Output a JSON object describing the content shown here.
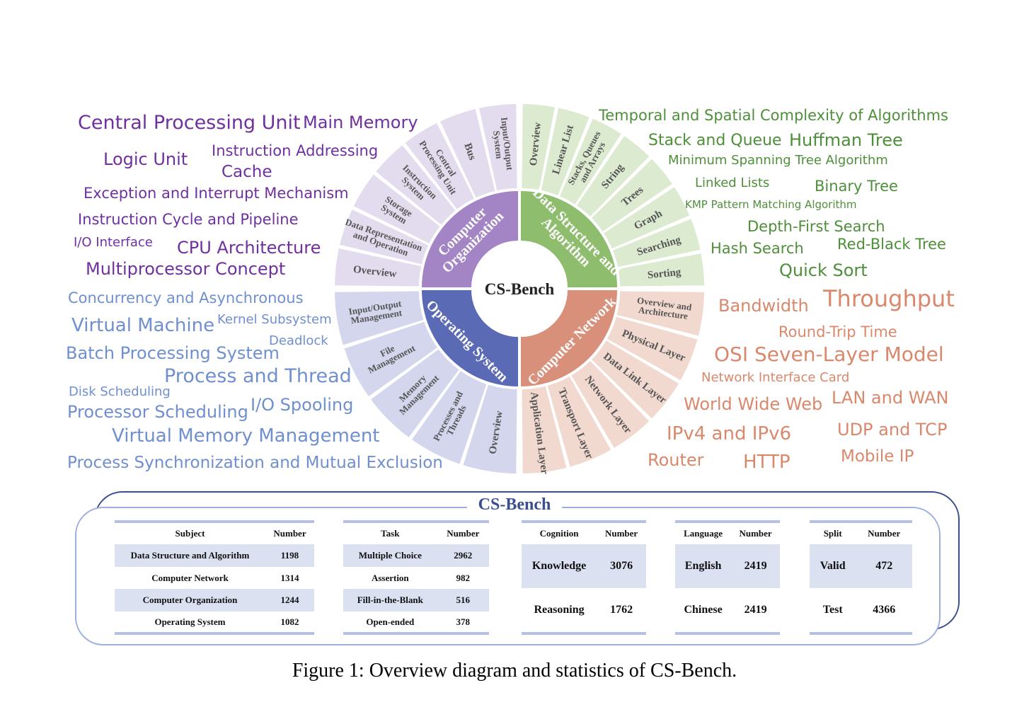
{
  "wheel": {
    "center_label": "CS-Bench",
    "sectors": [
      {
        "name": "Computer Organization",
        "lines": [
          "Computer",
          "Organization"
        ],
        "inner_color": "#a384c4",
        "outer_color": "#e3dbee",
        "subtopics": [
          [
            "Overview"
          ],
          [
            "Data Representation",
            "and Operation"
          ],
          [
            "Storage",
            "System"
          ],
          [
            "Instruction",
            "System"
          ],
          [
            "Central",
            "Processing Unit"
          ],
          [
            "Bus"
          ],
          [
            "Input/Output",
            "System"
          ]
        ]
      },
      {
        "name": "Data Structure and Algorithm",
        "lines": [
          "Data Structure and",
          "Algorithm"
        ],
        "inner_color": "#8fbd6e",
        "outer_color": "#dcead0",
        "subtopics": [
          [
            "Overview"
          ],
          [
            "Linear List"
          ],
          [
            "Stacks, Queues",
            "and Arrays"
          ],
          [
            "String"
          ],
          [
            "Trees"
          ],
          [
            "Graph"
          ],
          [
            "Searching"
          ],
          [
            "Sorting"
          ]
        ]
      },
      {
        "name": "Computer Network",
        "lines": [
          "Computer Network"
        ],
        "inner_color": "#d8907a",
        "outer_color": "#f2d9d0",
        "subtopics": [
          [
            "Overview and",
            "Architecture"
          ],
          [
            "Physical Layer"
          ],
          [
            "Data Link Layer"
          ],
          [
            "Network Layer"
          ],
          [
            "Transport Layer"
          ],
          [
            "Application Layer"
          ]
        ]
      },
      {
        "name": "Operating System",
        "lines": [
          "Operating System"
        ],
        "inner_color": "#5b6ab5",
        "outer_color": "#d3d6ec",
        "subtopics": [
          [
            "Input/Output",
            "Management"
          ],
          [
            "File",
            "Management"
          ],
          [
            "Memory",
            "Management"
          ],
          [
            "Processes and",
            "Threads"
          ],
          [
            "Overview"
          ]
        ]
      }
    ]
  },
  "word_clouds": {
    "computer_organization": {
      "color": "#7030a0",
      "words": [
        "Central Processing Unit",
        "Main Memory",
        "Logic Unit",
        "Instruction Addressing",
        "Cache",
        "Exception and Interrupt Mechanism",
        "Instruction Cycle and Pipeline",
        "I/O Interface",
        "CPU Architecture",
        "Multiprocessor Concept"
      ]
    },
    "data_structure": {
      "color": "#4e8f3a",
      "words": [
        "Temporal and Spatial Complexity of Algorithms",
        "Stack and Queue",
        "Huffman Tree",
        "Minimum Spanning Tree Algorithm",
        "Linked Lists",
        "Binary Tree",
        "KMP Pattern Matching Algorithm",
        "Depth-First Search",
        "Hash Search",
        "Red-Black Tree",
        "Quick Sort"
      ]
    },
    "operating_system": {
      "color": "#6f8fcf",
      "words": [
        "Concurrency and Asynchronous",
        "Virtual Machine",
        "Kernel Subsystem",
        "Deadlock",
        "Batch Processing System",
        "Process and Thread",
        "Disk Scheduling",
        "Processor Scheduling",
        "I/O Spooling",
        "Virtual Memory Management",
        "Process Synchronization and Mutual Exclusion"
      ]
    },
    "computer_network": {
      "color": "#d9886c",
      "words": [
        "Bandwidth",
        "Throughput",
        "Round-Trip Time",
        "OSI Seven-Layer Model",
        "Network Interface Card",
        "World Wide Web",
        "LAN and WAN",
        "IPv4 and IPv6",
        "UDP and TCP",
        "Router",
        "HTTP",
        "Mobile IP"
      ]
    }
  },
  "stats": {
    "title": "CS-Bench",
    "tables": [
      {
        "headers": [
          "Subject",
          "Number"
        ],
        "rows": [
          [
            "Data Structure and Algorithm",
            "1198"
          ],
          [
            "Computer Network",
            "1314"
          ],
          [
            "Computer Organization",
            "1244"
          ],
          [
            "Operating System",
            "1082"
          ]
        ]
      },
      {
        "headers": [
          "Task",
          "Number"
        ],
        "rows": [
          [
            "Multiple Choice",
            "2962"
          ],
          [
            "Assertion",
            "982"
          ],
          [
            "Fill-in-the-Blank",
            "516"
          ],
          [
            "Open-ended",
            "378"
          ]
        ]
      },
      {
        "headers": [
          "Cognition",
          "Number"
        ],
        "rows": [
          [
            "Knowledge",
            "3076"
          ],
          [
            "Reasoning",
            "1762"
          ]
        ]
      },
      {
        "headers": [
          "Language",
          "Number"
        ],
        "rows": [
          [
            "English",
            "2419"
          ],
          [
            "Chinese",
            "2419"
          ]
        ]
      },
      {
        "headers": [
          "Split",
          "Number"
        ],
        "rows": [
          [
            "Valid",
            "472"
          ],
          [
            "Test",
            "4366"
          ]
        ]
      }
    ]
  },
  "caption": "Figure 1: Overview diagram and statistics of CS-Bench."
}
